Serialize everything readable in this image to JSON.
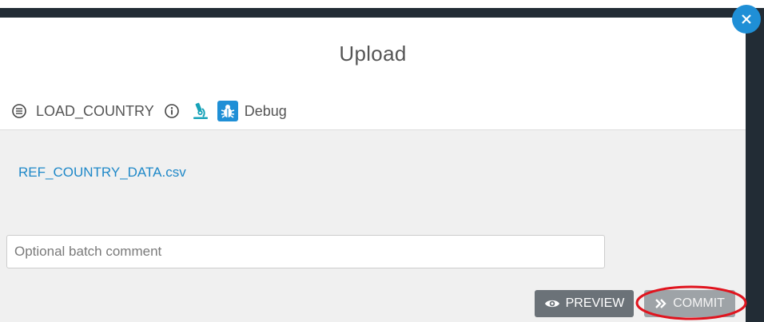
{
  "modal": {
    "title": "Upload",
    "toolbar": {
      "list_icon": "list-lines-icon",
      "load_name": "LOAD_COUNTRY",
      "info_icon": "info-circle-icon",
      "microscope_icon": "microscope-icon",
      "debug_icon": "bug-icon",
      "debug_label": "Debug"
    },
    "file": {
      "name": "REF_COUNTRY_DATA.csv"
    },
    "comment": {
      "placeholder": "Optional batch comment",
      "value": ""
    },
    "buttons": {
      "preview_label": "PREVIEW",
      "preview_icon": "eye-icon",
      "commit_label": "COMMIT",
      "commit_icon": "double-chevron-right-icon"
    },
    "close_icon": "close-icon"
  },
  "colors": {
    "accent": "#1f8fd6",
    "link": "#1e88c8",
    "microscope": "#17a2b8",
    "dark_frame": "#222c35",
    "highlight": "#e0141e",
    "preview_button": "#6b7278",
    "commit_button": "#9ea3a7"
  }
}
